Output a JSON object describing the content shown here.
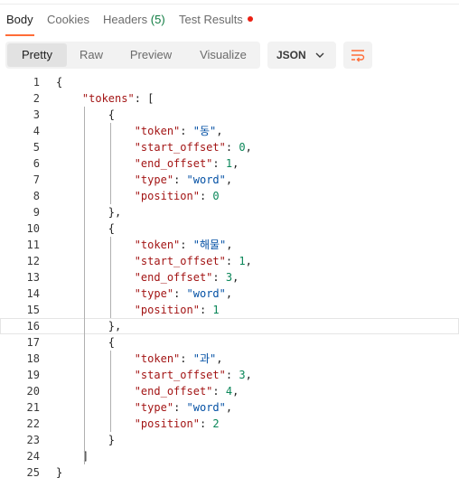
{
  "tabs": [
    {
      "label": "Body"
    },
    {
      "label": "Cookies"
    },
    {
      "label": "Headers",
      "count": "(5)"
    },
    {
      "label": "Test Results"
    }
  ],
  "view_modes": [
    {
      "label": "Pretty"
    },
    {
      "label": "Raw"
    },
    {
      "label": "Preview"
    },
    {
      "label": "Visualize"
    }
  ],
  "format": {
    "selected": "JSON"
  },
  "colors": {
    "accent": "#ff6c37",
    "key": "#a31515",
    "string": "#0451a5",
    "number": "#098658",
    "error_dot": "#eb2013"
  },
  "icons": {
    "format_chevron": "chevron-down-icon",
    "wrap": "wrap-lines-icon",
    "error_dot": "dot-icon"
  },
  "lines": [
    {
      "n": "1",
      "text": "{"
    },
    {
      "n": "2",
      "text": "    \"tokens\": ["
    },
    {
      "n": "3",
      "text": "        {"
    },
    {
      "n": "4",
      "text": "            \"token\": \"동\","
    },
    {
      "n": "5",
      "text": "            \"start_offset\": 0,"
    },
    {
      "n": "6",
      "text": "            \"end_offset\": 1,"
    },
    {
      "n": "7",
      "text": "            \"type\": \"word\","
    },
    {
      "n": "8",
      "text": "            \"position\": 0"
    },
    {
      "n": "9",
      "text": "        },"
    },
    {
      "n": "10",
      "text": "        {"
    },
    {
      "n": "11",
      "text": "            \"token\": \"해물\","
    },
    {
      "n": "12",
      "text": "            \"start_offset\": 1,"
    },
    {
      "n": "13",
      "text": "            \"end_offset\": 3,"
    },
    {
      "n": "14",
      "text": "            \"type\": \"word\","
    },
    {
      "n": "15",
      "text": "            \"position\": 1"
    },
    {
      "n": "16",
      "text": "        },"
    },
    {
      "n": "17",
      "text": "        {"
    },
    {
      "n": "18",
      "text": "            \"token\": \"과\","
    },
    {
      "n": "19",
      "text": "            \"start_offset\": 3,"
    },
    {
      "n": "20",
      "text": "            \"end_offset\": 4,"
    },
    {
      "n": "21",
      "text": "            \"type\": \"word\","
    },
    {
      "n": "22",
      "text": "            \"position\": 2"
    },
    {
      "n": "23",
      "text": "        }"
    },
    {
      "n": "24",
      "text": "    ]"
    },
    {
      "n": "25",
      "text": "}"
    }
  ]
}
